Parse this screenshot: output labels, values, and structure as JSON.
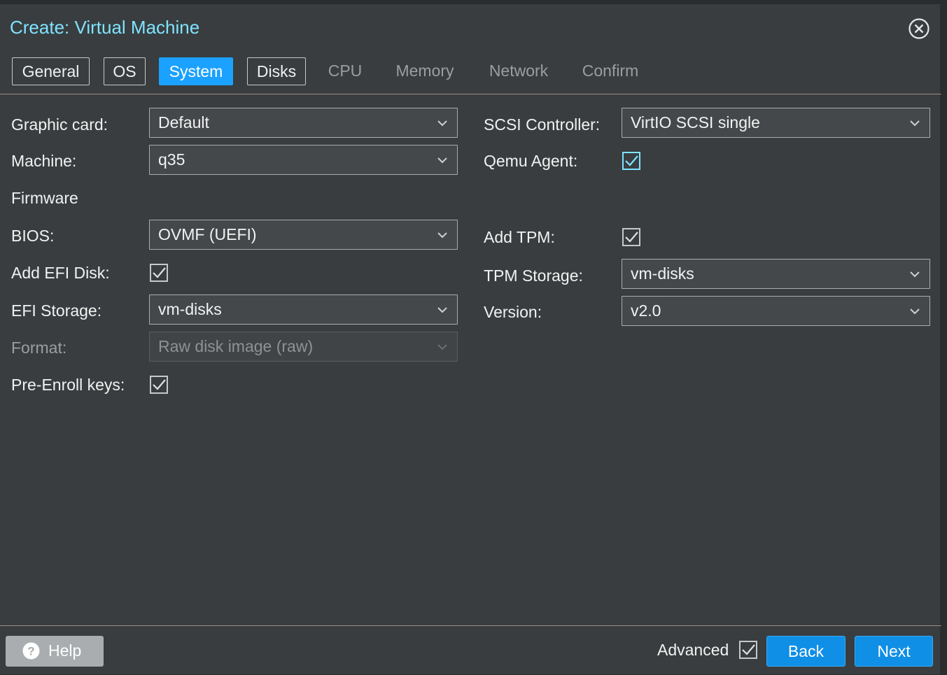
{
  "dialog": {
    "title": "Create: Virtual Machine",
    "accent_color": "#1ba1ff",
    "title_color": "#7fe3ff"
  },
  "tabs": [
    {
      "label": "General",
      "state": "enabled"
    },
    {
      "label": "OS",
      "state": "enabled"
    },
    {
      "label": "System",
      "state": "active"
    },
    {
      "label": "Disks",
      "state": "enabled"
    },
    {
      "label": "CPU",
      "state": "disabled"
    },
    {
      "label": "Memory",
      "state": "disabled"
    },
    {
      "label": "Network",
      "state": "disabled"
    },
    {
      "label": "Confirm",
      "state": "disabled"
    }
  ],
  "left": {
    "graphic_card": {
      "label": "Graphic card:",
      "value": "Default"
    },
    "machine": {
      "label": "Machine:",
      "value": "q35"
    },
    "firmware_header": "Firmware",
    "bios": {
      "label": "BIOS:",
      "value": "OVMF (UEFI)"
    },
    "add_efi_disk": {
      "label": "Add EFI Disk:",
      "checked": true
    },
    "efi_storage": {
      "label": "EFI Storage:",
      "value": "vm-disks"
    },
    "format": {
      "label": "Format:",
      "value": "Raw disk image (raw)",
      "disabled": true
    },
    "pre_enroll": {
      "label": "Pre-Enroll keys:",
      "checked": true
    }
  },
  "right": {
    "scsi_controller": {
      "label": "SCSI Controller:",
      "value": "VirtIO SCSI single"
    },
    "qemu_agent": {
      "label": "Qemu Agent:",
      "checked": true,
      "check_color": "#7fe3ff"
    },
    "add_tpm": {
      "label": "Add TPM:",
      "checked": true
    },
    "tpm_storage": {
      "label": "TPM Storage:",
      "value": "vm-disks"
    },
    "version": {
      "label": "Version:",
      "value": "v2.0"
    }
  },
  "footer": {
    "help_label": "Help",
    "advanced_label": "Advanced",
    "advanced_checked": true,
    "back_label": "Back",
    "next_label": "Next"
  },
  "icons": {
    "close": "close-circle-icon",
    "chevron": "chevron-down-icon",
    "help": "question-circle-icon",
    "checkbox": "checkbox-checked-icon"
  }
}
